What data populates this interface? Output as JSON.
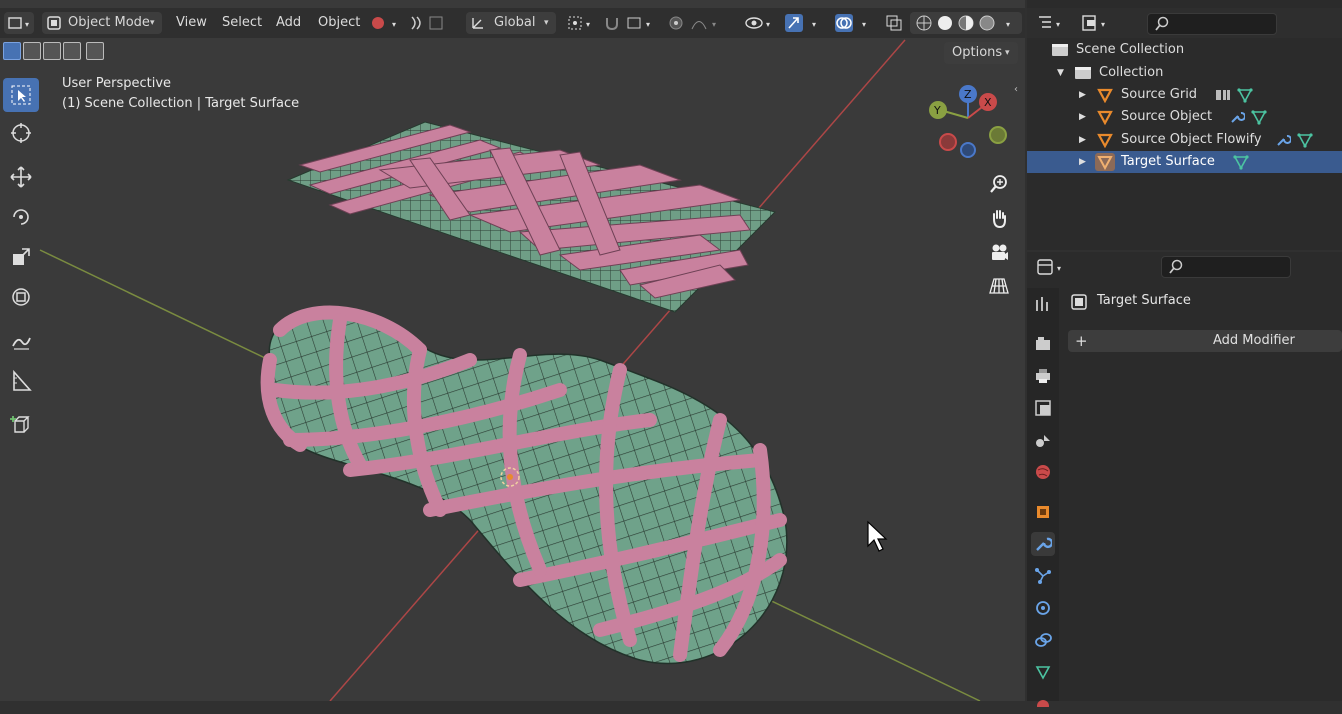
{
  "viewport": {
    "mode_label": "Object Mode",
    "menus": [
      "View",
      "Select",
      "Add",
      "Object"
    ],
    "transform_orientation": "Global",
    "options_label": "Options",
    "view_name": "User Perspective",
    "context_line": "(1) Scene Collection | Target Surface",
    "gizmo_axes": {
      "z": "Z",
      "y": "Y",
      "x": "X"
    }
  },
  "outliner": {
    "root": "Scene Collection",
    "collection": "Collection",
    "items": [
      {
        "label": "Source Grid",
        "selected": false
      },
      {
        "label": "Source Object",
        "selected": false
      },
      {
        "label": "Source Object Flowify",
        "selected": false
      },
      {
        "label": "Target Surface",
        "selected": true
      }
    ]
  },
  "properties": {
    "object_name": "Target Surface",
    "add_modifier_label": "Add Modifier",
    "add_icon": "+"
  },
  "colors": {
    "selection_blue": "#4772b3",
    "mesh_pink": "#c9819e",
    "mesh_green": "#6f9e86",
    "axis_red": "#c94a4a",
    "axis_green": "#8aa042",
    "object_orange": "#e98a2c"
  }
}
